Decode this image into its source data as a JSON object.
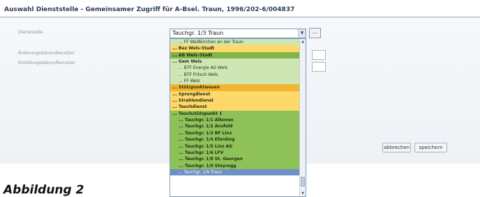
{
  "window": {
    "title": "Auswahl Dienststelle - Gemeinsamer Zugriff für A-Bsel. Traun, 1996/202-6/004837"
  },
  "form": {
    "dienststelle_label": "Dienststelle",
    "aenderung_label": "Änderungsdatum/Benutzer",
    "erstellung_label": "Erstellungsdatum/Benutzer",
    "selected_value": "Tauchgr. 1/3 Traun",
    "dots_label": "..."
  },
  "dropdown": {
    "options": [
      {
        "label": "FF Weißkirchen an der Traun",
        "style": "bg-lightgreen",
        "indent": 1,
        "bold": false
      },
      {
        "label": "Bez Wels-Stadt",
        "style": "bg-yellow",
        "indent": 0,
        "bold": true
      },
      {
        "label": "AB Wels-Stadt",
        "style": "bg-midgreen",
        "indent": 0,
        "bold": true
      },
      {
        "label": "Gem Wels",
        "style": "bg-lightgreen",
        "indent": 0,
        "bold": true
      },
      {
        "label": "BTF Energie AG Wels",
        "style": "bg-lightgreen",
        "indent": 1,
        "bold": false
      },
      {
        "label": "BTF Fritsch Wels",
        "style": "bg-lightgreen",
        "indent": 1,
        "bold": false
      },
      {
        "label": "FF Wels",
        "style": "bg-lightgreen",
        "indent": 1,
        "bold": false
      },
      {
        "label": "Stützpunktwesen",
        "style": "bg-orange",
        "indent": 0,
        "bold": true
      },
      {
        "label": "Sprengdienst",
        "style": "bg-yellow",
        "indent": 0,
        "bold": true
      },
      {
        "label": "Strahlendienst",
        "style": "bg-yellow",
        "indent": 0,
        "bold": true
      },
      {
        "label": "Tauchdienst",
        "style": "bg-yellow",
        "indent": 0,
        "bold": true
      },
      {
        "label": "Tauchstützpunkt 1",
        "style": "bg-green",
        "indent": 0,
        "bold": true
      },
      {
        "label": "Tauchgr. 1/1 Alkoven",
        "style": "bg-green",
        "indent": 1,
        "bold": true
      },
      {
        "label": "Tauchgr. 1/2 Ansfeld",
        "style": "bg-green",
        "indent": 1,
        "bold": true
      },
      {
        "label": "Tauchgr. 1/3 BF Linz",
        "style": "bg-green",
        "indent": 1,
        "bold": true
      },
      {
        "label": "Tauchgr. 1/4 Eferding",
        "style": "bg-green",
        "indent": 1,
        "bold": true
      },
      {
        "label": "Tauchgr. 1/5 Linz AG",
        "style": "bg-green",
        "indent": 1,
        "bold": true
      },
      {
        "label": "Tauchgr. 1/6 LFV",
        "style": "bg-green",
        "indent": 1,
        "bold": true
      },
      {
        "label": "Tauchgr. 1/8 St. Georgen",
        "style": "bg-green",
        "indent": 1,
        "bold": true
      },
      {
        "label": "Tauchgr. 1/9 Steyregg",
        "style": "bg-green",
        "indent": 1,
        "bold": true
      },
      {
        "label": "Tauchgr. 1/9 Traun",
        "style": "bg-selected",
        "indent": 1,
        "bold": false
      }
    ]
  },
  "actions": {
    "cancel_label": "abbrechen",
    "save_label": "speichern"
  },
  "caption": {
    "text": "Abbildung 2"
  },
  "icons": {
    "dropdown_arrow": "chevron-down-icon",
    "scroll_up": "chevron-up-icon",
    "scroll_down": "chevron-down-icon"
  },
  "colors": {
    "title_text": "#2f3f56",
    "panel_background": "#eef2f6",
    "selected_option": "#6e8fc7",
    "option_green": "#8ec158",
    "option_yellow": "#ffd86a",
    "option_orange": "#f3b530",
    "option_lightgreen": "#cfe6b4"
  }
}
